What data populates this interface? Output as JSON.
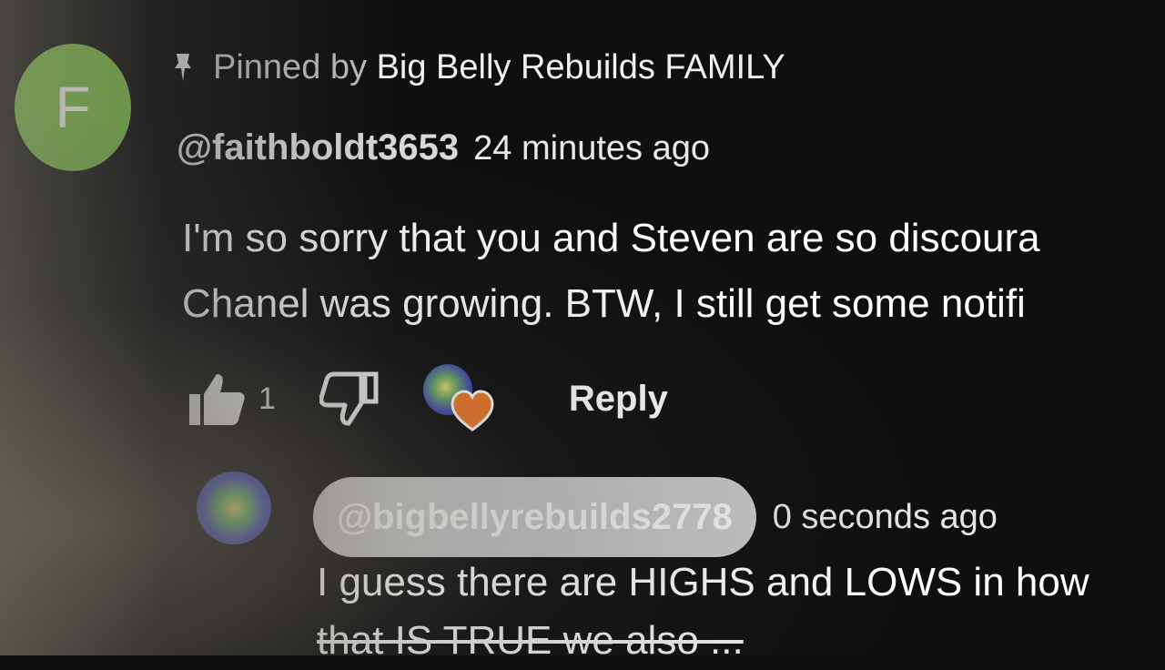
{
  "pinned": {
    "label": "Pinned by",
    "channel": "Big Belly Rebuilds FAMILY",
    "icon": "pin-icon"
  },
  "comment": {
    "avatar_letter": "F",
    "avatar_color": "#7cc04a",
    "handle": "@faithboldt3653",
    "timestamp": "24 minutes ago",
    "text_lines": [
      "I'm so sorry that you and Steven are so discoura",
      "Chanel was growing. BTW,  I still get some notifi"
    ],
    "like_count": "1",
    "reply_label": "Reply"
  },
  "reply": {
    "handle": "@bigbellyrebuilds2778",
    "timestamp": "0 seconds ago",
    "text_lines": [
      "I guess there are HIGHS and LOWS in how",
      "that IS TRUE we also ..."
    ]
  },
  "colors": {
    "heart": "#f07a2a",
    "owner_chip": "#c9c9c9"
  }
}
